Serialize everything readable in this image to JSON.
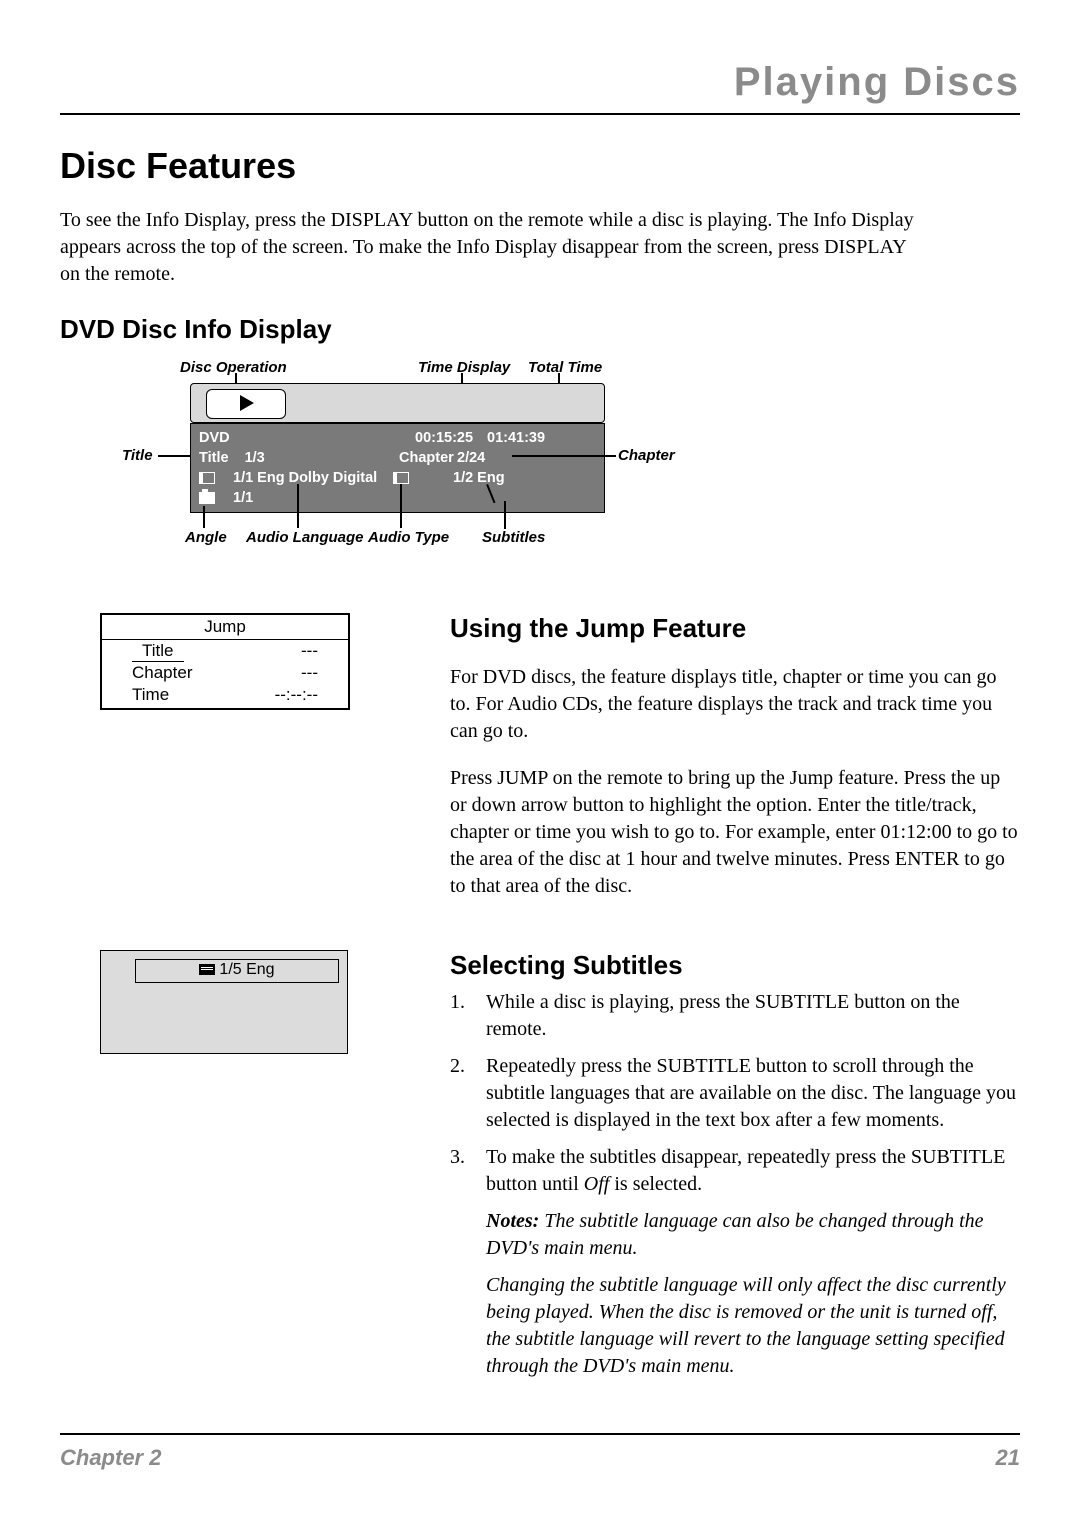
{
  "header": {
    "section_title": "Playing Discs"
  },
  "h1": "Disc Features",
  "intro": "To see the Info Display, press the DISPLAY button on the remote while a disc is playing. The Info Display appears across the top of the screen. To make the Info Display disappear from the screen, press DISPLAY on the remote.",
  "h2_dvd": "DVD Disc Info Display",
  "diagram": {
    "labels": {
      "disc_operation": "Disc Operation",
      "time_display": "Time Display",
      "total_time": "Total Time",
      "title": "Title",
      "chapter": "Chapter",
      "angle": "Angle",
      "audio_language": "Audio Language",
      "audio_type": "Audio Type",
      "subtitles": "Subtitles"
    },
    "panel": {
      "dvd": "DVD",
      "time": "00:15:25",
      "total": "01:41:39",
      "title_label": "Title",
      "title_value": "1/3",
      "chapter_label": "Chapter",
      "chapter_value": "2/24",
      "audio": "1/1 Eng Dolby Digital",
      "subs": "1/2 Eng",
      "angle": "1/1"
    }
  },
  "jump": {
    "header": "Jump",
    "rows": [
      {
        "label": "Title",
        "value": "---"
      },
      {
        "label": "Chapter",
        "value": "---"
      },
      {
        "label": "Time",
        "value": "--:--:--"
      }
    ]
  },
  "jump_section": {
    "heading": "Using the Jump Feature",
    "p1": "For DVD discs, the feature displays title, chapter or time you can go to. For Audio CDs, the feature displays the track and track time you can go to.",
    "p2": "Press JUMP on the remote to bring up the Jump feature. Press the up or down arrow button to highlight the option. Enter the title/track, chapter or time you wish to go to. For example, enter 01:12:00 to go to the area of the disc at 1 hour and twelve minutes. Press ENTER to go to that area of the disc."
  },
  "sub_box": {
    "text": "1/5 Eng"
  },
  "subs_section": {
    "heading": "Selecting Subtitles",
    "items": [
      "While a disc is playing, press the SUBTITLE button on the remote.",
      "Repeatedly press the SUBTITLE button to scroll through the subtitle languages that are available on the disc. The language you selected is displayed in the text box after a few moments."
    ],
    "item3_pre": "To make the subtitles disappear, repeatedly press the SUBTITLE button until ",
    "item3_off": "Off",
    "item3_post": " is selected.",
    "note1_label": "Notes:",
    "note1_body": " The subtitle language can also be changed through the DVD's main menu.",
    "note2": "Changing the subtitle language will only affect the disc currently being played. When the disc is removed or the unit is turned off, the subtitle language will revert to the language setting specified through the DVD's main menu."
  },
  "footer": {
    "chapter": "Chapter 2",
    "page": "21"
  }
}
